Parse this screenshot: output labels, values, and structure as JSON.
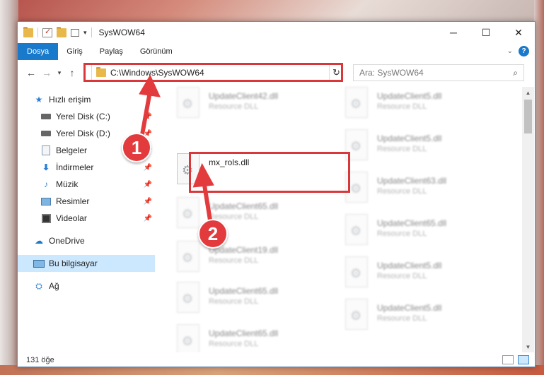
{
  "window": {
    "title": "SysWOW64"
  },
  "ribbon": {
    "tabs": [
      "Dosya",
      "Giriş",
      "Paylaş",
      "Görünüm"
    ]
  },
  "address_bar": {
    "path": "C:\\Windows\\SysWOW64"
  },
  "search": {
    "placeholder": "Ara: SysWOW64"
  },
  "sidebar": {
    "items": [
      {
        "label": "Hızlı erişim",
        "icon": "star-icon",
        "pinned": false
      },
      {
        "label": "Yerel Disk (C:)",
        "icon": "drive-icon",
        "pinned": true
      },
      {
        "label": "Yerel Disk (D:)",
        "icon": "drive-icon",
        "pinned": true
      },
      {
        "label": "Belgeler",
        "icon": "documents-icon",
        "pinned": true
      },
      {
        "label": "İndirmeler",
        "icon": "download-icon",
        "pinned": true
      },
      {
        "label": "Müzik",
        "icon": "music-icon",
        "pinned": true
      },
      {
        "label": "Resimler",
        "icon": "pictures-icon",
        "pinned": true
      },
      {
        "label": "Videolar",
        "icon": "video-icon",
        "pinned": true
      },
      {
        "label": "OneDrive",
        "icon": "cloud-icon",
        "pinned": false
      },
      {
        "label": "Bu bilgisayar",
        "icon": "pc-icon",
        "pinned": false,
        "selected": true
      },
      {
        "label": "Ağ",
        "icon": "network-icon",
        "pinned": false
      }
    ]
  },
  "files": {
    "highlighted": {
      "name": "mx_rols.dll",
      "type": ""
    },
    "col1": [
      {
        "name": "UpdateClient42.dll",
        "type": "Resource DLL"
      },
      {
        "name": "UpdateClient65.dll",
        "type": "Resource DLL"
      },
      {
        "name": "UpdateClient19.dll",
        "type": "Resource DLL"
      },
      {
        "name": "UpdateClient65.dll",
        "type": "Resource DLL"
      },
      {
        "name": "UpdateClient65.dll",
        "type": "Resource DLL"
      }
    ],
    "col2": [
      {
        "name": "UpdateClient5.dll",
        "type": "Resource DLL"
      },
      {
        "name": "UpdateClient5.dll",
        "type": "Resource DLL"
      },
      {
        "name": "UpdateClient63.dll",
        "type": "Resource DLL"
      },
      {
        "name": "UpdateClient65.dll",
        "type": "Resource DLL"
      },
      {
        "name": "UpdateClient5.dll",
        "type": "Resource DLL"
      },
      {
        "name": "UpdateClient5.dll",
        "type": "Resource DLL"
      }
    ]
  },
  "status": {
    "item_count": "131 öğe"
  },
  "annotations": {
    "step1": "1",
    "step2": "2",
    "color": "#e33b3d"
  }
}
